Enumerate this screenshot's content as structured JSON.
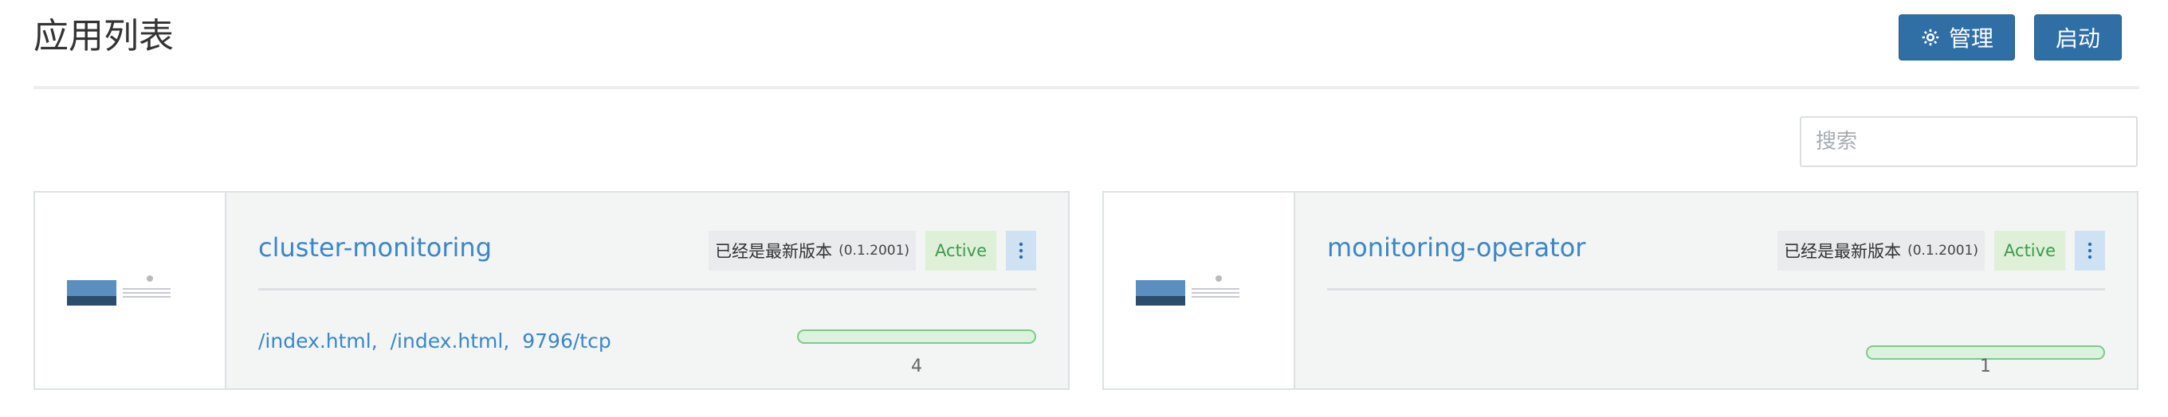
{
  "header": {
    "title": "应用列表",
    "manage_label": "管理",
    "start_label": "启动"
  },
  "search": {
    "placeholder": "搜索"
  },
  "apps": [
    {
      "name": "cluster-monitoring",
      "version_label": "已经是最新版本",
      "version": "(0.1.2001)",
      "status": "Active",
      "links": [
        "/index.html",
        "/index.html",
        "9796/tcp"
      ],
      "progress": 1.0,
      "count": "4"
    },
    {
      "name": "monitoring-operator",
      "version_label": "已经是最新版本",
      "version": "(0.1.2001)",
      "status": "Active",
      "links": [],
      "progress": 1.0,
      "count": "1"
    }
  ],
  "icons": {
    "manage": "gear-icon",
    "menu": "kebab-menu-icon",
    "thumbnail": "app-thumbnail"
  },
  "colors": {
    "primary": "#2f6fa6",
    "link": "#3a87c8",
    "active_bg": "#dff0d8",
    "active_text": "#3c9a4c",
    "progress": "#7ccb86"
  }
}
